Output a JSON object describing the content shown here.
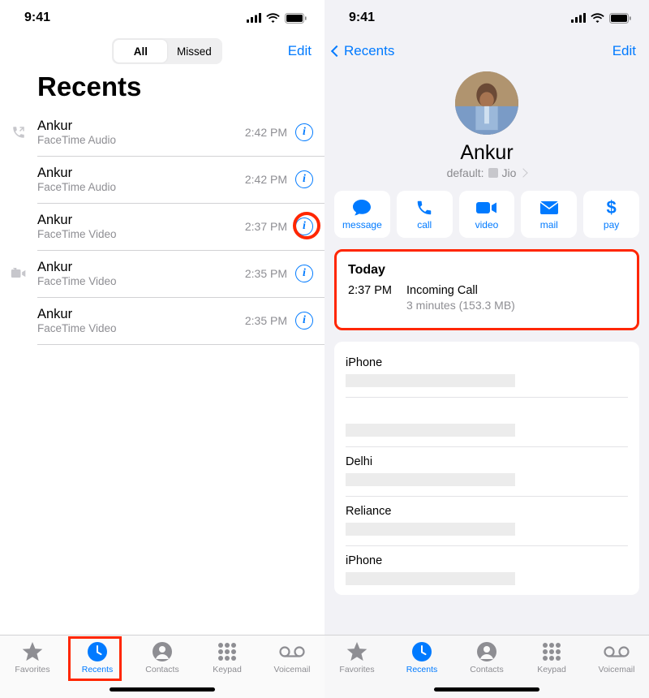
{
  "status": {
    "time": "9:41"
  },
  "left": {
    "seg": {
      "all": "All",
      "missed": "Missed"
    },
    "edit": "Edit",
    "title": "Recents",
    "calls": [
      {
        "name": "Ankur",
        "sub": "FaceTime Audio",
        "time": "2:42 PM",
        "icon": "outgoing"
      },
      {
        "name": "Ankur",
        "sub": "FaceTime Audio",
        "time": "2:42 PM",
        "icon": ""
      },
      {
        "name": "Ankur",
        "sub": "FaceTime Video",
        "time": "2:37 PM",
        "icon": "",
        "highlight": true
      },
      {
        "name": "Ankur",
        "sub": "FaceTime Video",
        "time": "2:35 PM",
        "icon": "outgoing-video"
      },
      {
        "name": "Ankur",
        "sub": "FaceTime Video",
        "time": "2:35 PM",
        "icon": ""
      }
    ]
  },
  "right": {
    "back": "Recents",
    "edit": "Edit",
    "name": "Ankur",
    "default_prefix": "default:",
    "default_carrier": "Jio",
    "actions": [
      {
        "key": "message",
        "label": "message"
      },
      {
        "key": "call",
        "label": "call"
      },
      {
        "key": "video",
        "label": "video"
      },
      {
        "key": "mail",
        "label": "mail"
      },
      {
        "key": "pay",
        "label": "pay"
      }
    ],
    "today": {
      "header": "Today",
      "time": "2:37 PM",
      "type": "Incoming Call",
      "detail": "3 minutes (153.3 MB)"
    },
    "fields": [
      {
        "label": "iPhone"
      },
      {
        "label": ""
      },
      {
        "label": "Delhi"
      },
      {
        "label": "Reliance"
      },
      {
        "label": "iPhone"
      }
    ]
  },
  "tabs": [
    {
      "key": "favorites",
      "label": "Favorites"
    },
    {
      "key": "recents",
      "label": "Recents"
    },
    {
      "key": "contacts",
      "label": "Contacts"
    },
    {
      "key": "keypad",
      "label": "Keypad"
    },
    {
      "key": "voicemail",
      "label": "Voicemail"
    }
  ]
}
